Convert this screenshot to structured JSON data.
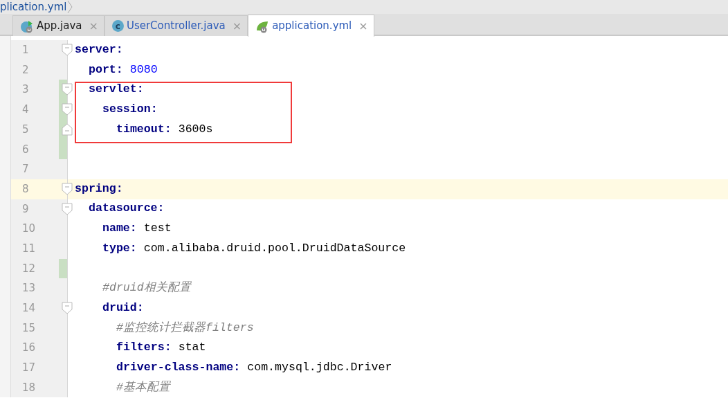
{
  "breadcrumb": {
    "text": "plication.yml"
  },
  "tabs": [
    {
      "label": "App.java",
      "selected": false,
      "kind": "run-class",
      "close": "×"
    },
    {
      "label": "UserController.java",
      "selected": false,
      "kind": "class",
      "icon_letter": "c",
      "close": "×"
    },
    {
      "label": "application.yml",
      "selected": true,
      "kind": "spring",
      "close": "×"
    }
  ],
  "lines": [
    {
      "number": "1",
      "fold_open": true,
      "tokens": [
        {
          "kind": "key",
          "text": "server:"
        }
      ],
      "children": [
        {
          "number": "2",
          "tokens": [
            {
              "kind": "key",
              "text": "port:"
            },
            {
              "kind": "number",
              "text": "8080"
            }
          ]
        },
        {
          "number": "3",
          "fold_open": true,
          "changed": true,
          "highlighted": true,
          "tokens": [
            {
              "kind": "key",
              "text": "servlet:"
            }
          ],
          "children": [
            {
              "number": "4",
              "fold_open": true,
              "changed": true,
              "highlighted": true,
              "tokens": [
                {
                  "kind": "key",
                  "text": "session:"
                }
              ],
              "children": [
                {
                  "number": "5",
                  "fold_close": true,
                  "changed": true,
                  "highlighted": true,
                  "tokens": [
                    {
                      "kind": "key",
                      "text": "timeout:"
                    },
                    {
                      "kind": "string",
                      "text": "3600s"
                    }
                  ]
                }
              ]
            }
          ]
        }
      ]
    },
    {
      "number": "6",
      "changed": true
    },
    {
      "number": "7"
    },
    {
      "number": "8",
      "fold_open": true,
      "current": true,
      "tokens": [
        {
          "kind": "key",
          "text": "spring:"
        }
      ],
      "children": [
        {
          "number": "9",
          "fold_open": true,
          "tokens": [
            {
              "kind": "key",
              "text": "datasource:"
            }
          ],
          "children": [
            {
              "number": "10",
              "tokens": [
                {
                  "kind": "key",
                  "text": "name:"
                },
                {
                  "kind": "string",
                  "text": "test"
                }
              ]
            },
            {
              "number": "11",
              "tokens": [
                {
                  "kind": "key",
                  "text": "type:"
                },
                {
                  "kind": "string",
                  "text": "com.alibaba.druid.pool.DruidDataSource"
                }
              ]
            },
            {
              "number": "12",
              "changed": true
            },
            {
              "number": "13",
              "tokens": [
                {
                  "kind": "comment",
                  "text": "#druid相关配置"
                }
              ]
            },
            {
              "number": "14",
              "fold_open": true,
              "tokens": [
                {
                  "kind": "key",
                  "text": "druid:"
                }
              ],
              "children": [
                {
                  "number": "15",
                  "tokens": [
                    {
                      "kind": "comment",
                      "text": "#监控统计拦截器filters"
                    }
                  ]
                },
                {
                  "number": "16",
                  "tokens": [
                    {
                      "kind": "key",
                      "text": "filters:"
                    },
                    {
                      "kind": "string",
                      "text": "stat"
                    }
                  ]
                },
                {
                  "number": "17",
                  "tokens": [
                    {
                      "kind": "key",
                      "text": "driver-class-name:"
                    },
                    {
                      "kind": "string",
                      "text": "com.mysql.jdbc.Driver"
                    }
                  ]
                },
                {
                  "number": "18",
                  "tokens": [
                    {
                      "kind": "comment",
                      "text": "#基本配置"
                    }
                  ]
                }
              ]
            }
          ]
        }
      ]
    }
  ]
}
